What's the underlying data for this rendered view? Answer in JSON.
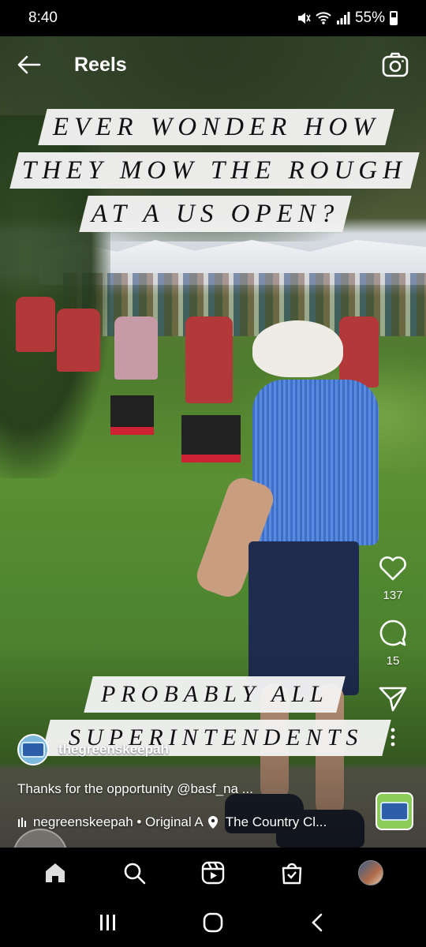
{
  "status_bar": {
    "time": "8:40",
    "battery_percent": "55%",
    "icons": [
      "mute-icon",
      "wifi-icon",
      "signal-icon",
      "battery-icon"
    ]
  },
  "header": {
    "title": "Reels",
    "back_icon": "back-arrow-icon",
    "camera_icon": "camera-icon"
  },
  "video": {
    "captions_top": [
      "EVER WONDER HOW",
      "THEY MOW THE ROUGH",
      "AT A US OPEN?"
    ],
    "captions_bottom": [
      "PROBABLY ALL",
      "SUPERINTENDENTS"
    ]
  },
  "actions": {
    "like_count": "137",
    "comment_count": "15",
    "icons": [
      "heart-icon",
      "comment-icon",
      "share-icon",
      "more-icon"
    ]
  },
  "post": {
    "username": "thegreenskeepah",
    "caption": "Thanks for the opportunity @basf_na ...",
    "audio_text": "​negreenskeepah • Original A",
    "location": "The Country Cl..."
  },
  "bottom_nav": {
    "items": [
      "home-icon",
      "search-icon",
      "reels-icon",
      "shop-icon",
      "profile-avatar"
    ]
  },
  "system_nav": {
    "items": [
      "recents-icon",
      "home-button-icon",
      "back-chevron-icon"
    ]
  },
  "colors": {
    "caption_bg": "#f2f2f2",
    "caption_text": "#111111",
    "nav_bg": "#000000"
  }
}
